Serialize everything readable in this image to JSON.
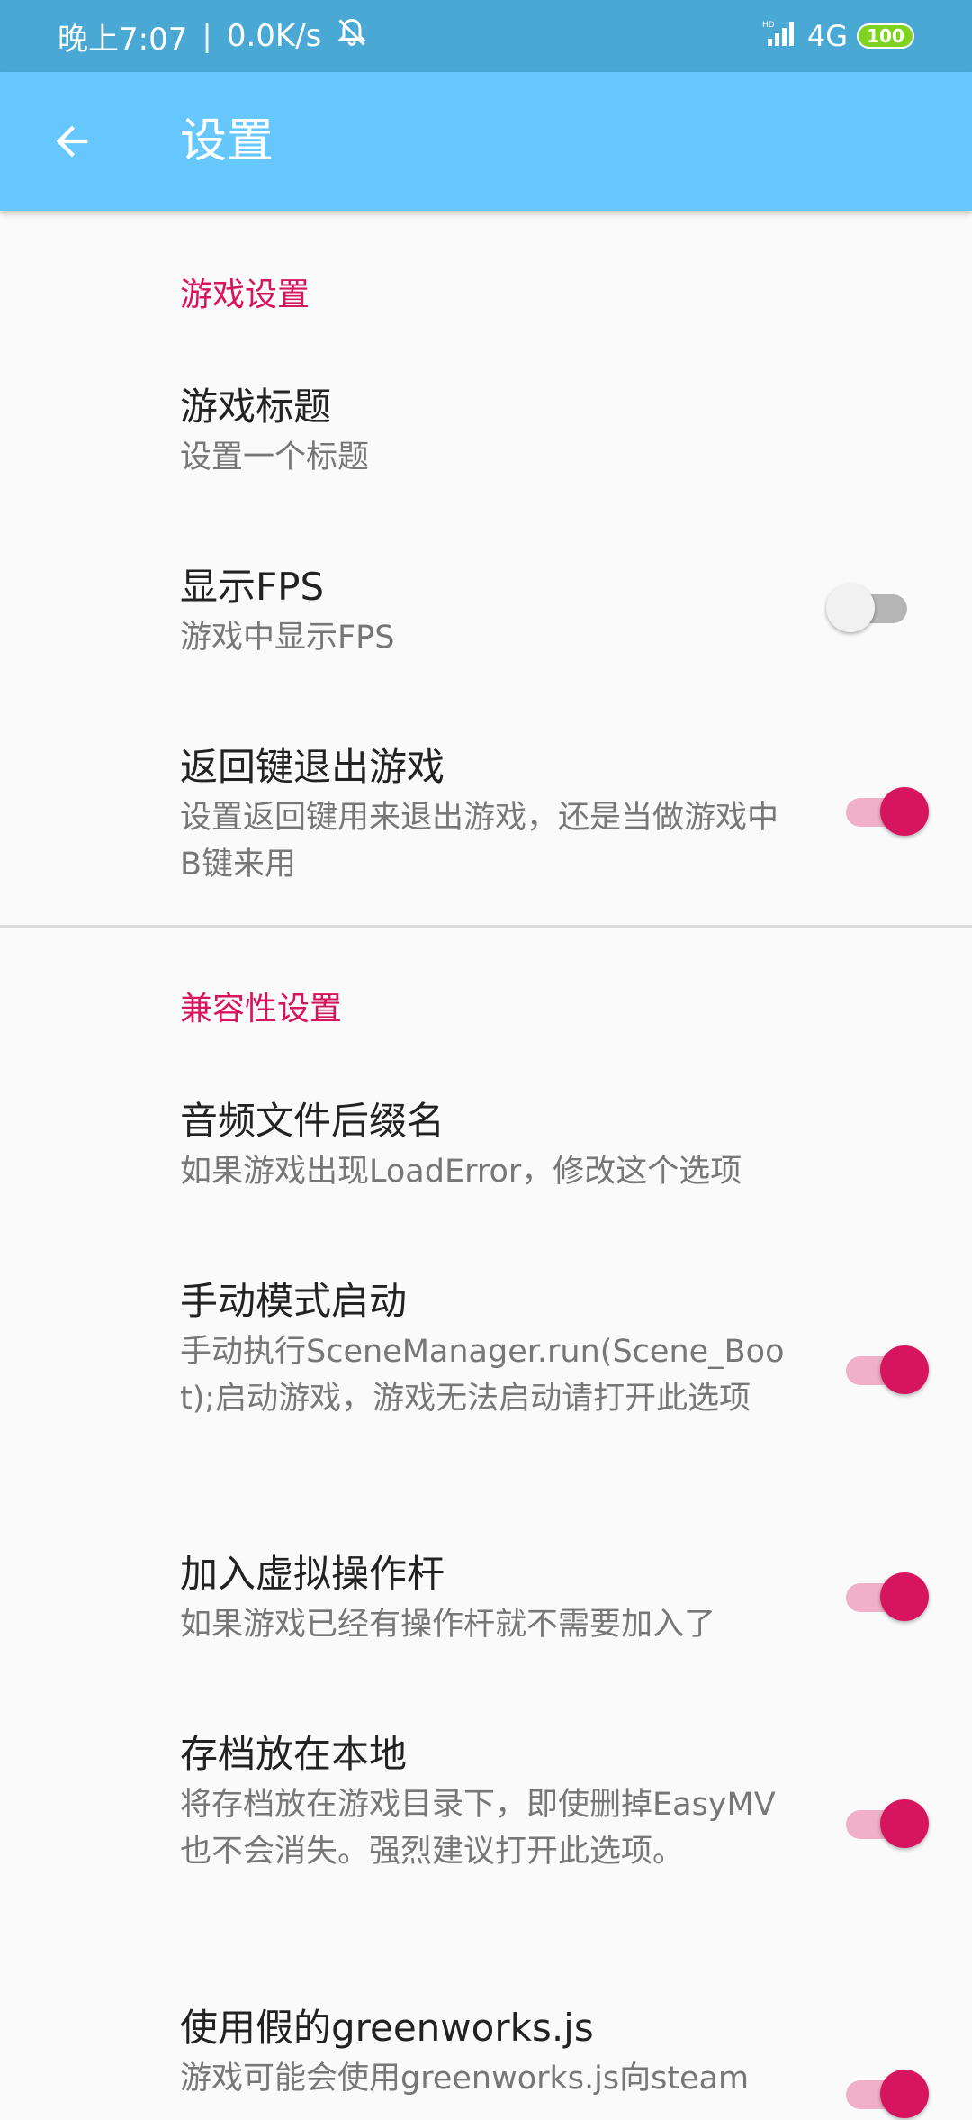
{
  "status_bar": {
    "time": "晚上7:07",
    "separator": "|",
    "speed": "0.0K/s",
    "network": "4G",
    "battery": "100",
    "icons": [
      "mute-bell-icon",
      "hd-signal-icon",
      "battery-icon"
    ]
  },
  "app_bar": {
    "title": "设置",
    "back_icon": "arrow-left-icon"
  },
  "colors": {
    "status_bar": "#4aa8d4",
    "app_bar": "#66c7fd",
    "accent": "#d6155e",
    "background": "#fafafa"
  },
  "sections": [
    {
      "header": "游戏设置",
      "items": [
        {
          "title": "游戏标题",
          "summary": "设置一个标题",
          "switch": null
        },
        {
          "title": "显示FPS",
          "summary": "游戏中显示FPS",
          "switch": false
        },
        {
          "title": "返回键退出游戏",
          "summary": "设置返回键用来退出游戏，还是当做游戏中B键来用",
          "switch": true
        }
      ]
    },
    {
      "header": "兼容性设置",
      "items": [
        {
          "title": "音频文件后缀名",
          "summary": "如果游戏出现LoadError，修改这个选项",
          "switch": null
        },
        {
          "title": "手动模式启动",
          "summary": "手动执行SceneManager.run(Scene_Boot);启动游戏，游戏无法启动请打开此选项",
          "switch": true
        },
        {
          "title": "加入虚拟操作杆",
          "summary": "如果游戏已经有操作杆就不需要加入了",
          "switch": true
        },
        {
          "title": "存档放在本地",
          "summary": "将存档放在游戏目录下，即使删掉EasyMV也不会消失。强烈建议打开此选项。",
          "switch": true
        },
        {
          "title": "使用假的greenworks.js",
          "summary": "游戏可能会使用greenworks.js向steam",
          "switch": true
        }
      ]
    }
  ]
}
